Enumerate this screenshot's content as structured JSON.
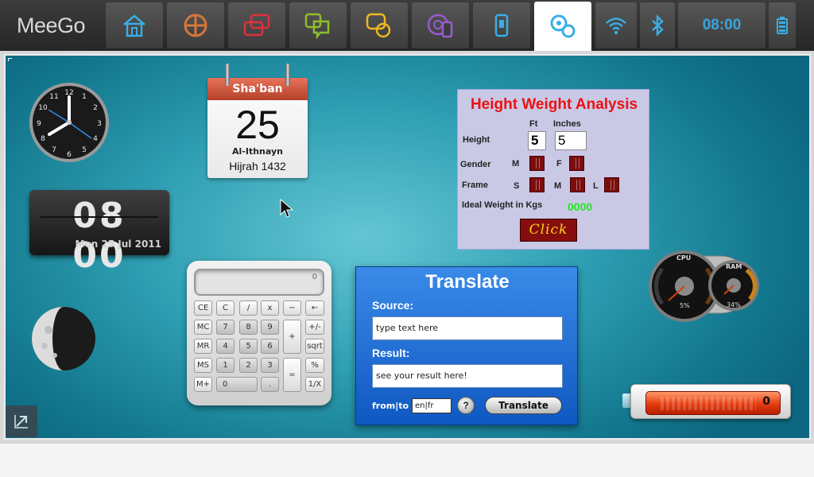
{
  "topbar": {
    "logo": "MeeGo",
    "clock": "08:00",
    "zones": [
      {
        "name": "home",
        "icon": "home-icon"
      },
      {
        "name": "applications",
        "icon": "applications-icon"
      },
      {
        "name": "zones",
        "icon": "zones-icon"
      },
      {
        "name": "status",
        "icon": "status-icon"
      },
      {
        "name": "people",
        "icon": "people-icon"
      },
      {
        "name": "media",
        "icon": "media-icon"
      },
      {
        "name": "devices",
        "icon": "devices-icon"
      },
      {
        "name": "myzone",
        "icon": "myzone-icon",
        "active": true
      },
      {
        "name": "wifi",
        "icon": "wifi-icon"
      },
      {
        "name": "bluetooth",
        "icon": "bluetooth-icon"
      },
      {
        "name": "battery",
        "icon": "battery-icon"
      }
    ]
  },
  "flip_clock": {
    "time": "08 00",
    "date": "Mon 25 Jul 2011"
  },
  "hijri_calendar": {
    "month": "Sha'ban",
    "day": "25",
    "day_name": "Al-Ithnayn",
    "year": "Hijrah 1432"
  },
  "hwa": {
    "title": "Height Weight Analysis",
    "col_ft": "Ft",
    "col_inches": "Inches",
    "height_label": "Height",
    "height_ft": "5",
    "height_in": "5",
    "gender_label": "Gender",
    "gender_m": "M",
    "gender_f": "F",
    "frame_label": "Frame",
    "frame_s": "S",
    "frame_m": "M",
    "frame_l": "L",
    "ideal_label": "Ideal Weight in Kgs",
    "ideal_value": "0000",
    "button": "Click"
  },
  "calculator": {
    "display": "0",
    "keys": [
      "CE",
      "C",
      "/",
      "x",
      "−",
      "←",
      "MC",
      "7",
      "8",
      "9",
      "+",
      "+/-",
      "MR",
      "4",
      "5",
      "6",
      "sqrt",
      "MS",
      "1",
      "2",
      "3",
      "=",
      "%",
      "M+",
      "0",
      ".",
      "1/X"
    ]
  },
  "translate": {
    "title": "Translate",
    "source_label": "Source:",
    "source_value": "type text here",
    "result_label": "Result:",
    "result_value": "see your result here!",
    "fromto_label": "from|to",
    "lang_value": "en|fr",
    "help": "?",
    "button": "Translate"
  },
  "gauges": {
    "cpu_label": "CPU",
    "cpu_value": "5%",
    "ram_label": "RAM",
    "ram_value": "34%"
  },
  "battery_widget": {
    "value": "0"
  }
}
